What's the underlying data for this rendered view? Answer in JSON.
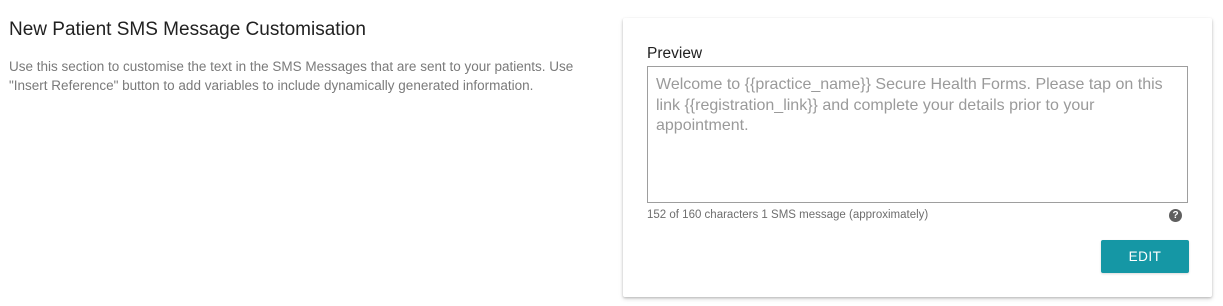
{
  "section": {
    "title": "New Patient SMS Message Customisation",
    "description": "Use this section to customise the text in the SMS Messages that are sent to your patients. Use \"Insert Reference\" button to add variables to include dynamically generated information."
  },
  "preview": {
    "label": "Preview",
    "message": "Welcome to {{practice_name}} Secure Health Forms. Please tap on this link {{registration_link}} and complete your details prior to your appointment.",
    "char_count_text": "152 of 160 characters 1 SMS message (approximately)",
    "characters_used": 152,
    "characters_max": 160,
    "sms_count": 1,
    "help_icon_glyph": "?",
    "help_icon": "question-circle-icon"
  },
  "actions": {
    "edit_label": "EDIT"
  },
  "colors": {
    "accent": "#1597a5",
    "title_text": "#212121",
    "muted_text": "#7a7a7a",
    "placeholder_text": "#9a9a9a"
  }
}
